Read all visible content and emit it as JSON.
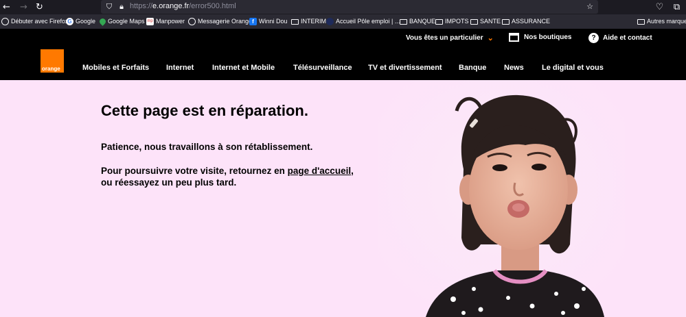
{
  "browser": {
    "url_prefix": "https://",
    "url_host": "e.orange.fr",
    "url_path": "/error500.html"
  },
  "bookmarks": [
    {
      "label": "Débuter avec Firefox",
      "icon": "globe-icon"
    },
    {
      "label": "Google",
      "icon": "google-icon"
    },
    {
      "label": "Google Maps",
      "icon": "maps-icon"
    },
    {
      "label": "Manpower",
      "icon": "manpower-icon"
    },
    {
      "label": "Messagerie Orange",
      "icon": "globe-icon"
    },
    {
      "label": "Winni Dou",
      "icon": "facebook-icon"
    },
    {
      "label": "INTERIM",
      "icon": "folder-icon"
    },
    {
      "label": "Accueil Pôle emploi | ...",
      "icon": "pole-emploi-icon"
    },
    {
      "label": "BANQUE",
      "icon": "folder-icon"
    },
    {
      "label": "IMPOTS",
      "icon": "folder-icon"
    },
    {
      "label": "SANTE",
      "icon": "folder-icon"
    },
    {
      "label": "ASSURANCE",
      "icon": "folder-icon"
    },
    {
      "label": "Autres marque-p",
      "icon": "folder-icon"
    }
  ],
  "header": {
    "utility": {
      "particulier": "Vous êtes un particulier",
      "boutiques": "Nos boutiques",
      "aide": "Aide et contact"
    },
    "logo_text": "orange",
    "nav": [
      "Mobiles et Forfaits",
      "Internet",
      "Internet et Mobile",
      "Télésurveillance",
      "TV et divertissement",
      "Banque",
      "News",
      "Le digital et vous"
    ]
  },
  "main": {
    "title": "Cette page est en réparation.",
    "line1": "Patience, nous travaillons à son rétablissement.",
    "line2_before": "Pour poursuivre votre visite, retournez en ",
    "line2_link": "page d'accueil",
    "line2_after": ",",
    "line3": "ou réessayez un peu plus tard."
  },
  "colors": {
    "brand": "#ff7900",
    "page_background": "#fde3f9",
    "header_background": "#000000"
  }
}
